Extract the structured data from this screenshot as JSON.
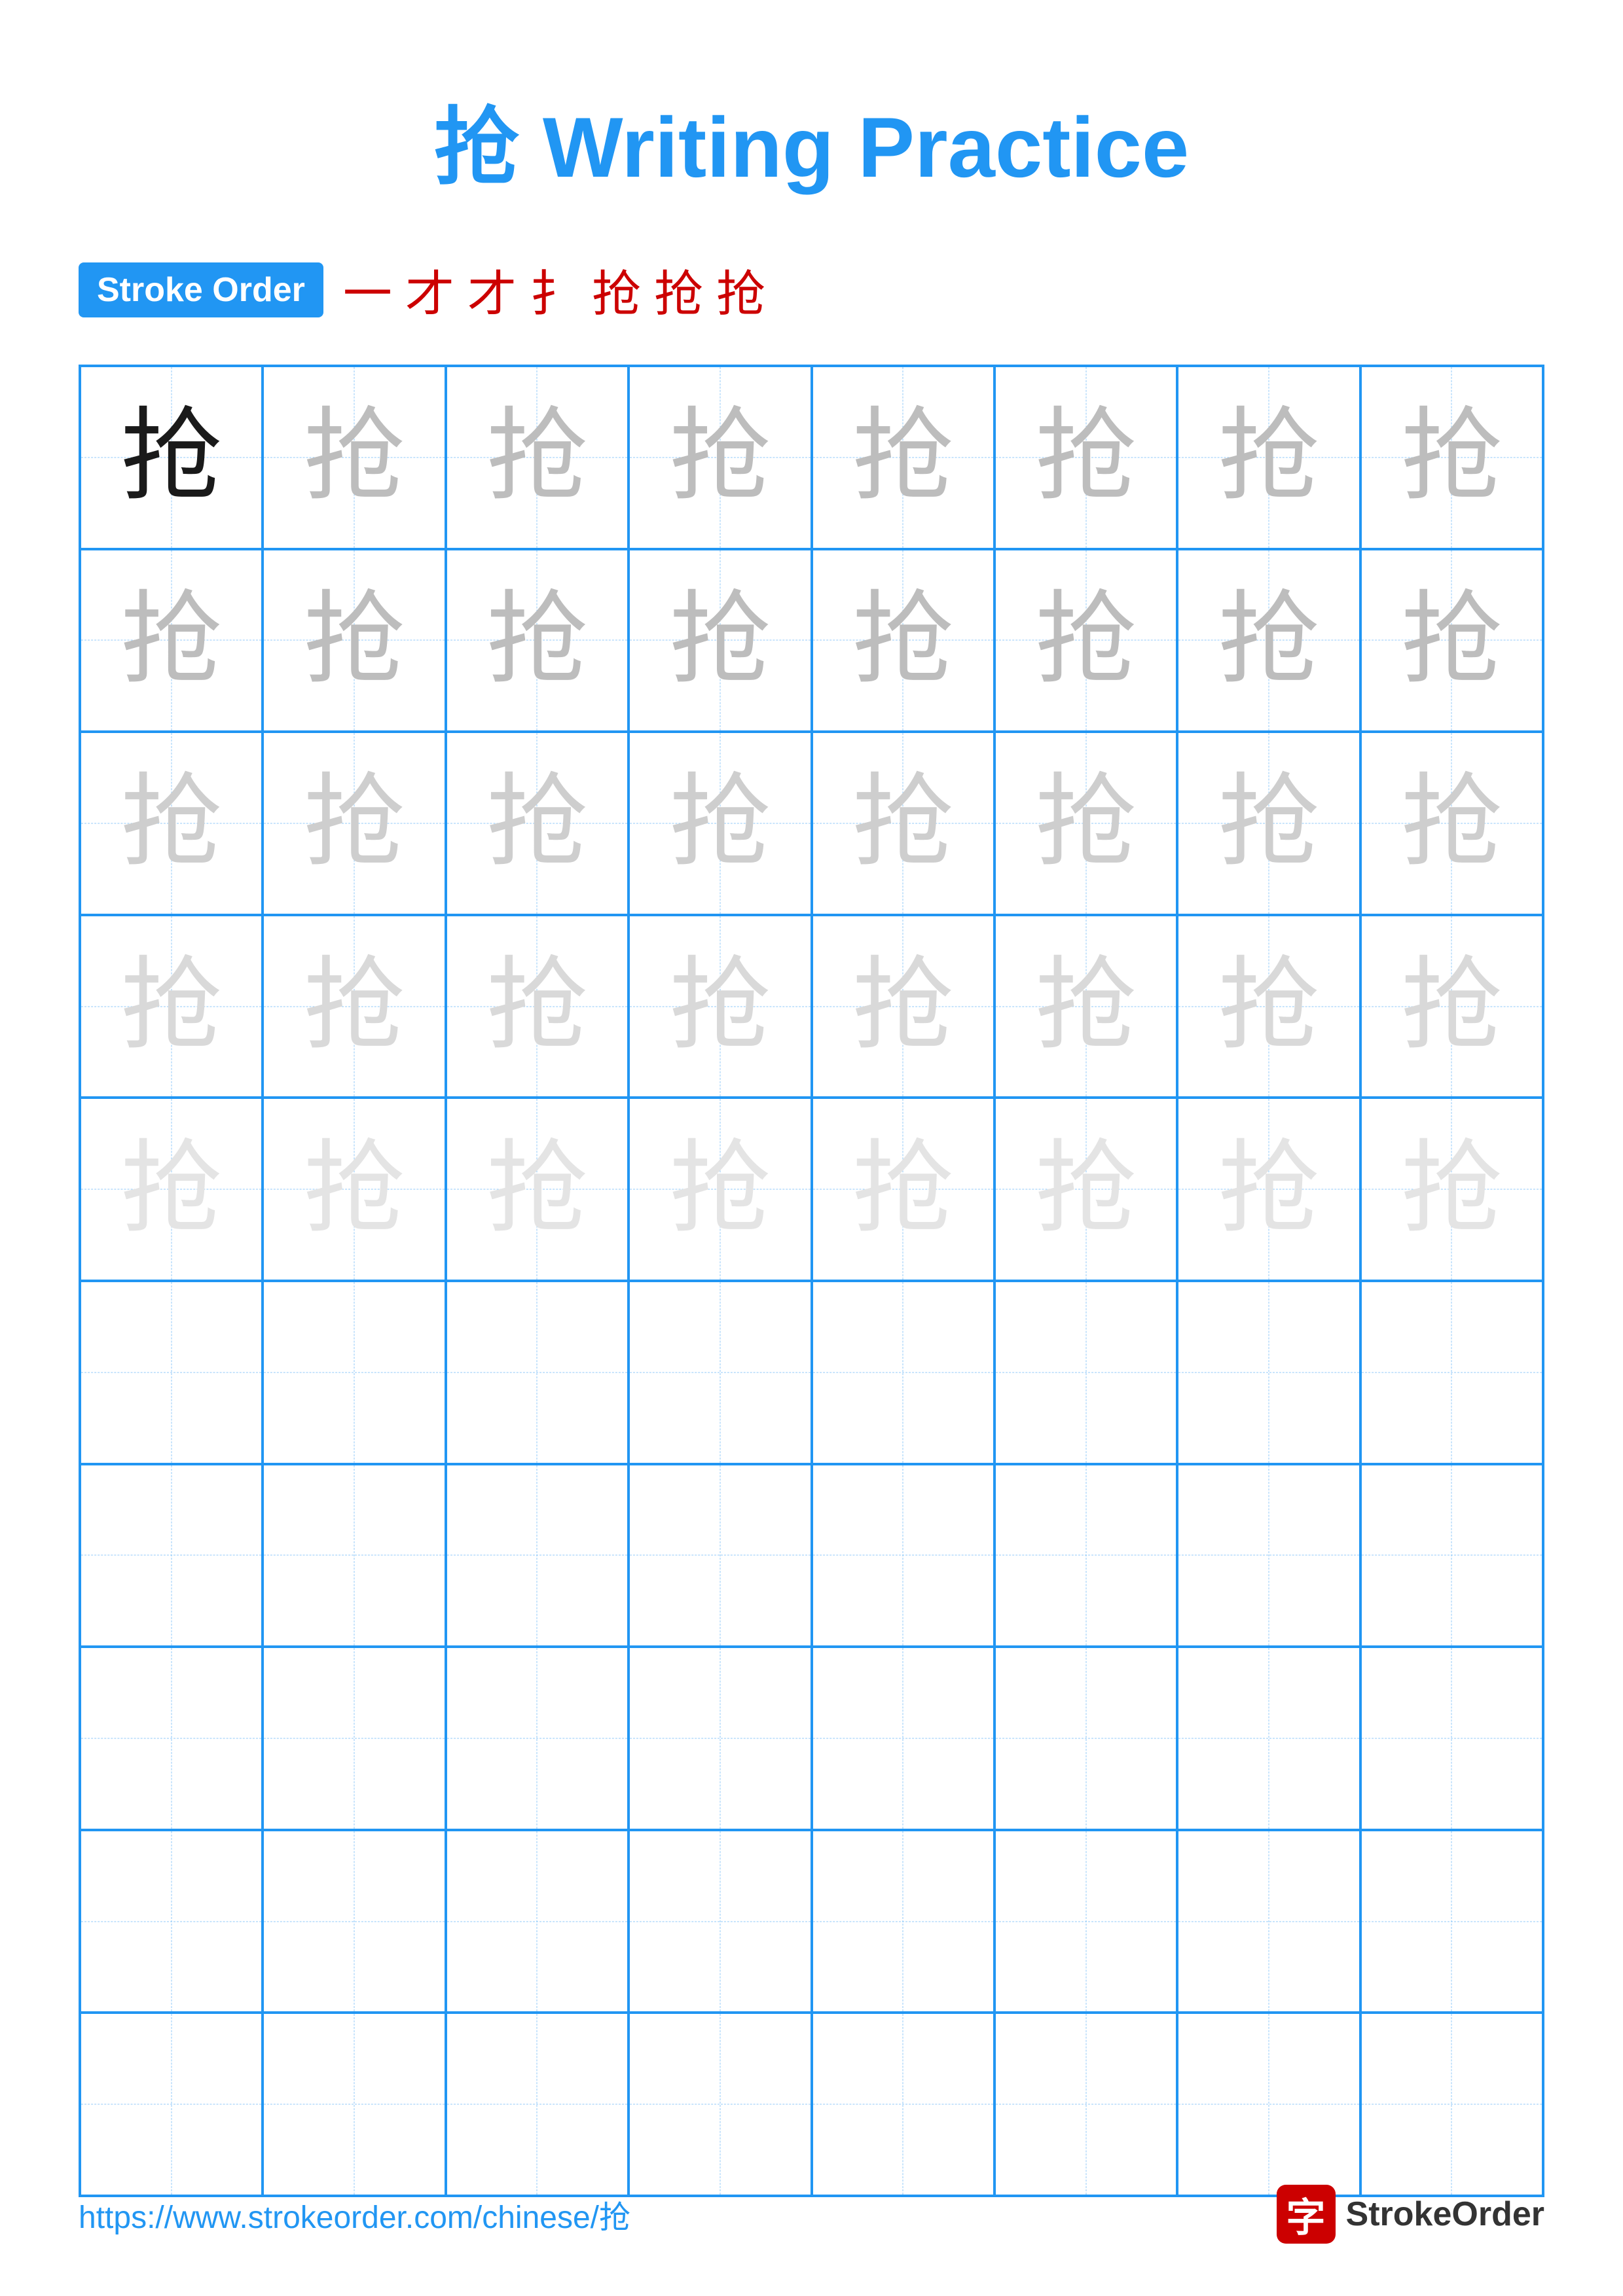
{
  "title": "抢 Writing Practice",
  "stroke_order_badge": "Stroke Order",
  "stroke_steps": [
    "一",
    "才",
    "才",
    "扌",
    "抢",
    "抢",
    "抢"
  ],
  "character": "抢",
  "grid": {
    "rows": 10,
    "cols": 8
  },
  "footer_url": "https://www.strokeorder.com/chinese/抢",
  "footer_logo_char": "字",
  "footer_logo_text": "StrokeOrder"
}
